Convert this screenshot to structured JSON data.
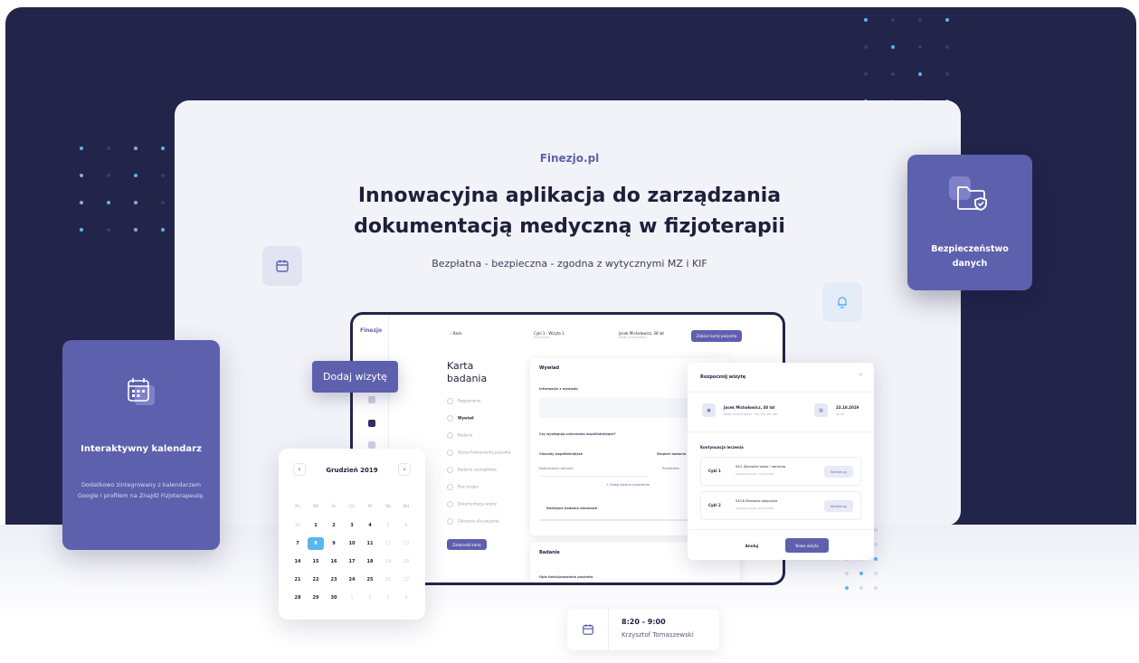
{
  "hero": {
    "brand": "Finezjo.pl",
    "headline_line1": "Innowacyjna aplikacja do zarządzania",
    "headline_line2": "dokumentacją medyczną w fizjoterapii",
    "subline": "Bezpłatna - bezpieczna - zgodna z wytycznymi MZ i KIF"
  },
  "app": {
    "logo": "Finezjo",
    "page_title_line1": "Karta",
    "page_title_line2": "badania",
    "steps": [
      "Rozpoznanie",
      "Wywiad",
      "Badanie",
      "Ocena funkcjonalna pacjenta",
      "Badanie szczegółowe",
      "Plan terapii",
      "Dokumentacja wizyty",
      "Zalecenia dla pacjenta"
    ],
    "save_button": "Zatwierdź kartę",
    "top_visit": "Cykl 1 - Wizyta 1",
    "top_visit_sub": "25.10.2019",
    "top_patient": "Jacek Michałowicz, 38 lat",
    "top_patient_sub": "PESEL 91010100001",
    "top_button": "Zobacz kartę pacjenta",
    "panel_title": "Wywiad",
    "panel_label1": "Informacje z wywiadu",
    "panel_label2": "Czy występują schorzenia współistniejące?",
    "panel_label3": "Choroby współistniejące",
    "panel_label4": "Stopień badania",
    "panel_select": "Nadciśnienie tętnicze",
    "panel_select2": "Przewlekłe",
    "panel_add": "+ Dodaj kolejne schorzenie",
    "panel_label5": "Dostępne badania obrazowe",
    "panel2_title": "Badanie",
    "panel2_label": "Opis funkcjonowania pacjenta"
  },
  "modal": {
    "title": "Rozpocznij wizytę",
    "close": "×",
    "patient_name": "Jacek Michałowicz, 38 lat",
    "patient_sub": "PESEL 91010100001  ·  TEL 730 452 980",
    "date": "23.10.2019",
    "time": "15:30",
    "section": "Kontynuacja leczenia",
    "cycles": [
      {
        "label": "Cykl 1",
        "title": "S43. Złamanie barku i ramienia",
        "sub": "Ostatnia wizyta: 12.04.2019",
        "button": "Kontynuuj"
      },
      {
        "label": "Cykl 2",
        "title": "S43.8 Złamanie obojczyka",
        "sub": "Ostatnia wizyta: 20.04.2019",
        "button": "Kontynuuj"
      }
    ],
    "cancel": "Anuluj",
    "confirm": "Nowa wizyta"
  },
  "dodaj_button": "Dodaj wizytę",
  "calendar_card": {
    "title": "Interaktywny kalendarz",
    "description": "Dodatkowo zintegrowany z kalendarzem Google i profilem na Znajdź Fizjoterapeutę."
  },
  "calendar": {
    "month": "Grudzień 2019",
    "prev": "‹",
    "next": "›",
    "weekdays": [
      "Pn",
      "Wt",
      "Śr",
      "Cz",
      "Pt",
      "Sb",
      "Nd"
    ],
    "selected_day": "8"
  },
  "security_card": {
    "title_line1": "Bezpieczeństwo",
    "title_line2": "danych"
  },
  "appointment": {
    "time": "8:20 - 9:00",
    "name": "Krzysztof Tomaszewski"
  },
  "colors": {
    "navy": "#23244a",
    "accent": "#5d60ad",
    "highlight": "#5ab5f0"
  },
  "icons": [
    "calendar-icon",
    "bell-icon",
    "folder-shield-icon"
  ]
}
